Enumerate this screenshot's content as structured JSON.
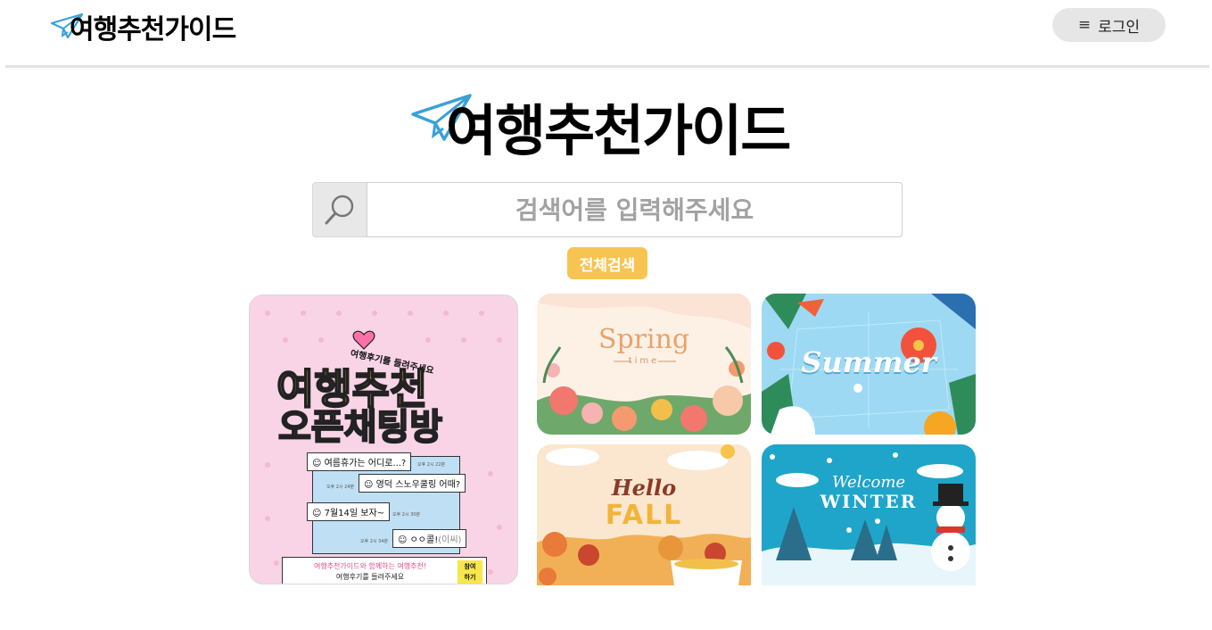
{
  "header": {
    "logo_text": "여행추천가이드",
    "login_label": "로그인",
    "menu_icon": "hamburger-icon"
  },
  "hero": {
    "logo_text": "여행추천가이드",
    "logo_icon": "paper-plane-icon"
  },
  "search": {
    "placeholder": "검색어를 입력해주세요",
    "icon": "search-icon",
    "all_search_label": "전체검색"
  },
  "cards": {
    "event": {
      "tag": "여행후기를 들려주세요",
      "title_line1": "여행추천",
      "title_line2": "오픈채팅방",
      "chats": [
        {
          "text": "여름휴가는 어디로...?",
          "time": "오후 2시 22분"
        },
        {
          "text": "영덕 스노우쿨링 어때?",
          "time": "오후 2시 24분"
        },
        {
          "text": "7월14일 보자~",
          "time": "오후 2시 30분"
        },
        {
          "text": "ㅇㅇ콜!",
          "extra": "(이씨)",
          "time": "오후 2시 34분"
        }
      ],
      "bottom_line1": "여행추천가이드와 함께하는 여행추천!",
      "bottom_line2": "여행후기를 들려주세요",
      "join_label_1": "참여",
      "join_label_2": "하기"
    },
    "spring": {
      "title": "Spring",
      "subtitle": "time"
    },
    "summer": {
      "title": "Summer"
    },
    "fall": {
      "title1": "Hello",
      "title2": "FALL"
    },
    "winter": {
      "title1": "Welcome",
      "title2": "WINTER"
    }
  },
  "colors": {
    "accent_button": "#f7c451",
    "login_bg": "#e6e6e6",
    "plane_blue": "#3aa1d8"
  }
}
